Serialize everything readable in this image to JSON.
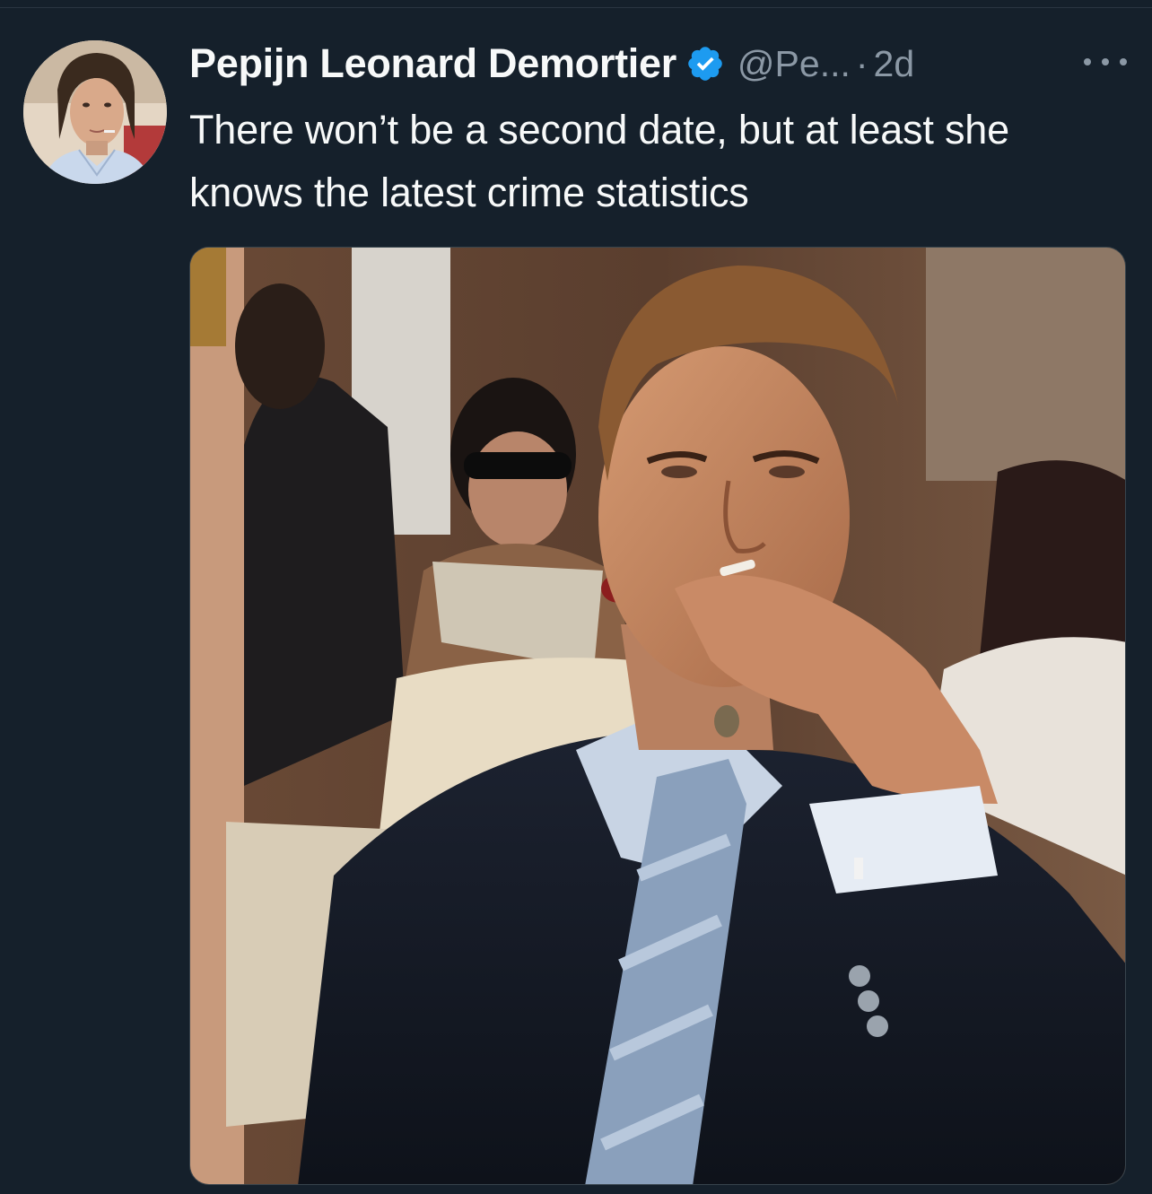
{
  "tweet": {
    "author": {
      "display_name": "Pepijn Leonard Demortier",
      "handle": "@Pe...",
      "verified": true,
      "avatar_icon": "profile-photo"
    },
    "separator": "·",
    "time": "2d",
    "more_icon": "ellipsis-icon",
    "text": "There won’t be a second date, but at least she knows the latest crime statistics",
    "media": {
      "type": "photo"
    }
  },
  "colors": {
    "background": "#15202b",
    "primary_text": "#f7f9f9",
    "secondary_text": "#8b98a5",
    "verified_badge": "#1d9bf0"
  }
}
